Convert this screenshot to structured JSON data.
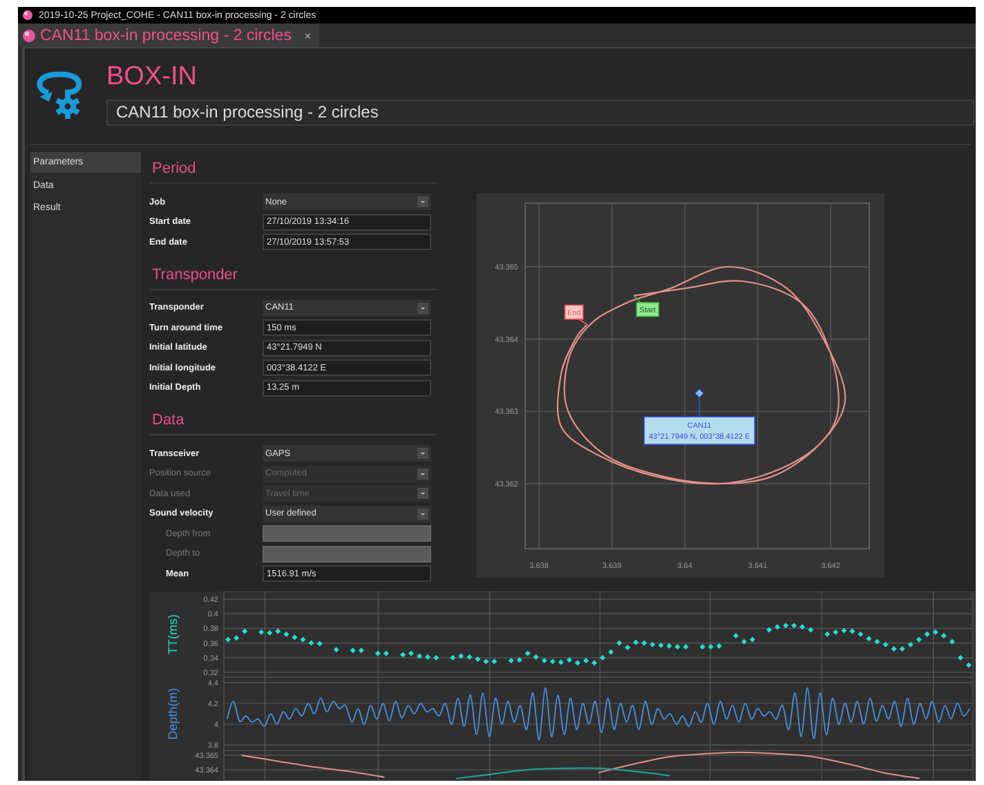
{
  "window": {
    "title": "2019-10-25 Project_COHE - CAN11 box-in processing - 2 circles"
  },
  "tabs": [
    {
      "label": "CAN11 box-in processing - 2 circles",
      "close": "×",
      "selected": true
    }
  ],
  "header": {
    "heading": "BOX-IN",
    "title": "CAN11 box-in processing - 2 circles"
  },
  "sidebar": {
    "items": [
      {
        "label": "Parameters",
        "selected": true
      },
      {
        "label": "Data",
        "selected": false
      },
      {
        "label": "Result",
        "selected": false
      }
    ]
  },
  "sections": [
    {
      "title": "Period",
      "rows": [
        {
          "label": "Job",
          "kind": "select",
          "value": "None",
          "disabled": false
        },
        {
          "label": "Start date",
          "kind": "input",
          "value": "27/10/2019 13:34:16",
          "disabled": false
        },
        {
          "label": "End date",
          "kind": "input",
          "value": "27/10/2019 13:57:53",
          "disabled": false
        }
      ]
    },
    {
      "title": "Transponder",
      "rows": [
        {
          "label": "Transponder",
          "kind": "select",
          "value": "CAN11",
          "disabled": false
        },
        {
          "label": "Turn around time",
          "kind": "input",
          "value": "150 ms",
          "disabled": false
        },
        {
          "label": "Initial latitude",
          "kind": "input",
          "value": "43°21.7949 N",
          "disabled": false
        },
        {
          "label": "Initial longitude",
          "kind": "input",
          "value": "003°38.4122 E",
          "disabled": false
        },
        {
          "label": "Initial Depth",
          "kind": "input",
          "value": "13.25 m",
          "disabled": false
        }
      ]
    },
    {
      "title": "Data",
      "rows": [
        {
          "label": "Transceiver",
          "kind": "select",
          "value": "GAPS",
          "disabled": false
        },
        {
          "label": "Position source",
          "kind": "select",
          "value": "Computed",
          "disabled": true
        },
        {
          "label": "Data used",
          "kind": "select",
          "value": "Travel time",
          "disabled": true
        },
        {
          "label": "Sound velocity",
          "kind": "select",
          "value": "User defined",
          "disabled": false,
          "children": [
            {
              "label": "Depth from",
              "kind": "blank",
              "disabled": true
            },
            {
              "label": "Depth to",
              "kind": "blank",
              "disabled": true
            },
            {
              "label": "Mean",
              "kind": "input",
              "value": "1516.91 m/s",
              "disabled": false
            }
          ]
        }
      ]
    }
  ],
  "trajectory": {
    "chart_data": {
      "type": "line",
      "grid": true,
      "x": [
        3.6393,
        3.64,
        3.6408,
        3.6416,
        3.642,
        3.6421,
        3.6418,
        3.6412,
        3.6405,
        3.6397,
        3.6389,
        3.6384,
        3.6384,
        3.6387,
        3.6392,
        3.6398,
        3.6406,
        3.6414,
        3.6419,
        3.6422,
        3.6419,
        3.6413,
        3.6405,
        3.6396,
        3.6388,
        3.6383,
        3.6383,
        3.6385,
        3.63866
      ],
      "series": [
        {
          "color": "#e0908a",
          "values": [
            43.3646,
            43.3647,
            43.3648,
            43.3645,
            43.3638,
            43.363,
            43.3625,
            43.3621,
            43.362,
            43.3621,
            43.3624,
            43.363,
            43.3637,
            43.3642,
            43.3645,
            43.3647,
            43.365,
            43.3647,
            43.364,
            43.3632,
            43.3626,
            43.3622,
            43.362,
            43.3621,
            43.3624,
            43.3628,
            43.3635,
            43.364,
            43.3642
          ]
        }
      ],
      "xlim": [
        3.63781,
        3.64253
      ],
      "ylim": [
        43.3611,
        43.36588
      ],
      "xticks": [
        3.638,
        3.639,
        3.64,
        3.641,
        3.642
      ],
      "yticks": [
        43.362,
        43.363,
        43.364,
        43.365
      ],
      "annotations": [
        {
          "text": "End",
          "x": 3.63866,
          "y": 43.3642
        },
        {
          "text": "Start",
          "x": 3.6393,
          "y": 43.3646
        },
        {
          "text": "CAN11",
          "x": 3.6402,
          "y": 43.36325
        }
      ]
    },
    "markers": [
      {
        "kind": "end",
        "color": "#ffc8c8"
      },
      {
        "kind": "start",
        "color": "#90e890"
      },
      {
        "kind": "target",
        "color": "#b4dcec",
        "detail": "43°21.7949 N, 003°38.4122 E"
      }
    ]
  },
  "timeline": [
    {
      "chart_data": {
        "type": "scatter",
        "grid": true,
        "ylabel": "TT(ms)",
        "ylim": [
          0.3134,
          0.4304
        ],
        "yticks": [
          0.32,
          0.34,
          0.36,
          0.38,
          0.4,
          0.42
        ],
        "series": [
          {
            "color": "#20e0d0",
            "values": [
              0.365,
              0.367,
              0.376,
              null,
              0.375,
              0.374,
              0.376,
              0.372,
              0.368,
              0.365,
              0.36,
              0.359,
              null,
              0.351,
              null,
              0.35,
              0.35,
              null,
              0.346,
              0.346,
              null,
              0.344,
              0.346,
              0.342,
              0.341,
              0.34,
              null,
              0.34,
              0.342,
              0.341,
              0.338,
              0.335,
              0.335,
              null,
              0.336,
              0.337,
              0.346,
              0.341,
              0.336,
              0.335,
              0.334,
              0.337,
              0.333,
              0.336,
              0.333,
              0.34,
              0.348,
              0.36,
              0.354,
              0.361,
              0.36,
              0.358,
              0.357,
              0.356,
              0.355,
              0.355,
              null,
              0.355,
              0.355,
              0.356,
              null,
              0.37,
              0.362,
              0.365,
              null,
              0.378,
              0.382,
              0.384,
              0.384,
              0.382,
              0.378,
              null,
              0.372,
              0.375,
              0.377,
              0.376,
              0.372,
              0.366,
              0.362,
              0.358,
              0.352,
              0.352,
              0.358,
              0.365,
              0.372,
              0.375,
              0.37,
              0.362,
              0.34,
              0.33
            ]
          }
        ]
      }
    },
    {
      "chart_data": {
        "type": "line",
        "grid": true,
        "ylabel": "Depth(m)",
        "ylim": [
          3.747,
          4.453
        ],
        "yticks": [
          3.8,
          4,
          4.2,
          4.4
        ],
        "series": [
          {
            "color": "#4a90e0",
            "values": [
              4.05,
              4.22,
              4.03,
              4.08,
              4.02,
              4.05,
              3.98,
              4.1,
              4.0,
              4.12,
              4.05,
              4.15,
              4.08,
              4.2,
              4.1,
              4.25,
              4.12,
              4.22,
              4.15,
              4.18,
              4.02,
              4.15,
              4.0,
              4.18,
              4.05,
              4.2,
              4.03,
              4.22,
              4.06,
              4.18,
              4.1,
              4.2,
              4.12,
              4.15,
              4.08,
              4.2,
              4.0,
              4.25,
              3.98,
              4.28,
              3.9,
              4.3,
              3.88,
              4.25,
              4.0,
              4.22,
              4.02,
              4.18,
              3.95,
              4.3,
              3.85,
              4.35,
              3.88,
              4.28,
              3.9,
              4.25,
              3.95,
              4.2,
              4.0,
              4.22,
              3.92,
              4.25,
              3.95,
              4.2,
              4.02,
              4.18,
              3.95,
              4.22,
              4.0,
              4.15,
              4.05,
              4.1,
              4.0,
              4.08,
              3.98,
              4.12,
              4.02,
              4.2,
              4.0,
              4.22,
              4.05,
              4.18,
              4.02,
              4.2,
              4.05,
              4.15,
              4.08,
              4.12,
              4.05,
              4.18,
              3.95,
              4.3,
              3.88,
              4.35,
              3.86,
              4.3,
              3.9,
              4.25,
              4.0,
              4.2,
              4.02,
              4.22,
              4.0,
              4.25,
              4.03,
              4.18,
              4.05,
              4.22,
              3.98,
              4.25,
              4.0,
              4.2,
              4.05,
              4.22,
              4.02,
              4.18,
              4.05,
              4.2,
              4.08,
              4.15
            ]
          }
        ]
      }
    },
    {
      "chart_data": {
        "type": "line",
        "grid": true,
        "ylim": [
          43.36324,
          43.36533
        ],
        "yticks": [
          43.364,
          43.365
        ],
        "series": [
          {
            "color": "#e0908a",
            "values": [
              43.365,
              43.3646,
              43.3642,
              43.3639,
              43.3635,
              null,
              null,
              null,
              null,
              null,
              43.3638,
              43.3644,
              43.3649,
              43.3651,
              43.3652,
              43.3651,
              43.3649,
              43.3644,
              43.3638,
              43.3634,
              null
            ]
          },
          {
            "color": "#20a898",
            "values": [
              null,
              null,
              null,
              null,
              null,
              null,
              43.3634,
              43.3637,
              43.364,
              43.3641,
              43.3641,
              43.3639,
              43.3636,
              null,
              null,
              null,
              null,
              null,
              null,
              null,
              null
            ]
          }
        ]
      }
    }
  ]
}
